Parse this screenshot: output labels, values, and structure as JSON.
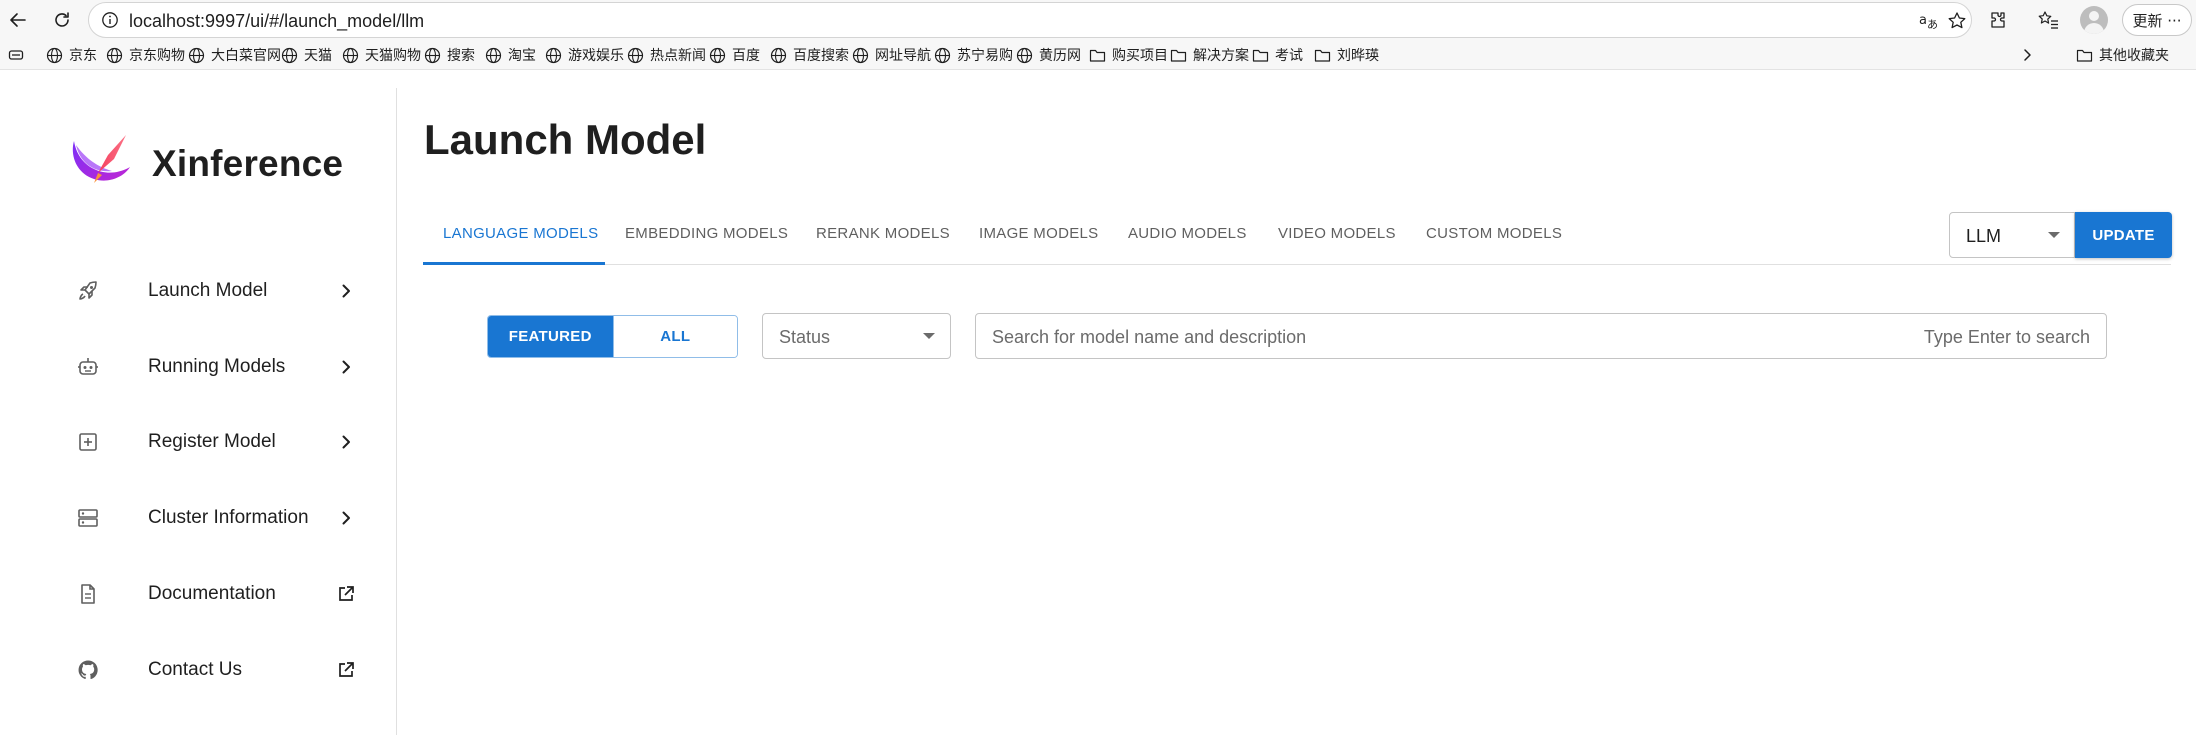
{
  "browser": {
    "url": "localhost:9997/ui/#/launch_model/llm",
    "update_label": "更新 ···"
  },
  "bookmarks": [
    {
      "label": "京东",
      "icon": "globe-icon"
    },
    {
      "label": "京东购物",
      "icon": "globe-icon"
    },
    {
      "label": "大白菜官网",
      "icon": "globe-icon"
    },
    {
      "label": "天猫",
      "icon": "globe-icon"
    },
    {
      "label": "天猫购物",
      "icon": "globe-icon"
    },
    {
      "label": "搜索",
      "icon": "globe-icon"
    },
    {
      "label": "淘宝",
      "icon": "globe-icon"
    },
    {
      "label": "游戏娱乐",
      "icon": "globe-icon"
    },
    {
      "label": "热点新闻",
      "icon": "globe-icon"
    },
    {
      "label": "百度",
      "icon": "globe-icon"
    },
    {
      "label": "百度搜索",
      "icon": "globe-icon"
    },
    {
      "label": "网址导航",
      "icon": "globe-icon"
    },
    {
      "label": "苏宁易购",
      "icon": "globe-icon"
    },
    {
      "label": "黄历网",
      "icon": "globe-icon"
    },
    {
      "label": "购买项目",
      "icon": "folder-icon"
    },
    {
      "label": "解决方案",
      "icon": "folder-icon"
    },
    {
      "label": "考试",
      "icon": "folder-icon"
    },
    {
      "label": "刘晔瑛",
      "icon": "folder-icon"
    }
  ],
  "bookmarks_other": "其他收藏夹",
  "sidebar": {
    "brand": "Xinference",
    "items": [
      {
        "label": "Launch Model",
        "icon": "rocket-icon",
        "trail": "chevron-right-icon"
      },
      {
        "label": "Running Models",
        "icon": "robot-icon",
        "trail": "chevron-right-icon"
      },
      {
        "label": "Register Model",
        "icon": "add-box-icon",
        "trail": "chevron-right-icon"
      },
      {
        "label": "Cluster Information",
        "icon": "server-icon",
        "trail": "chevron-right-icon"
      },
      {
        "label": "Documentation",
        "icon": "document-icon",
        "trail": "open-in-new-icon"
      },
      {
        "label": "Contact Us",
        "icon": "github-icon",
        "trail": "open-in-new-icon"
      }
    ]
  },
  "main": {
    "title": "Launch Model",
    "tabs": [
      {
        "label": "LANGUAGE MODELS",
        "active": true
      },
      {
        "label": "EMBEDDING MODELS",
        "active": false
      },
      {
        "label": "RERANK MODELS",
        "active": false
      },
      {
        "label": "IMAGE MODELS",
        "active": false
      },
      {
        "label": "AUDIO MODELS",
        "active": false
      },
      {
        "label": "VIDEO MODELS",
        "active": false
      },
      {
        "label": "CUSTOM MODELS",
        "active": false
      }
    ],
    "model_type_select": "LLM",
    "update_button": "UPDATE",
    "filter_toggle": {
      "featured": "FEATURED",
      "all": "ALL",
      "selected": "FEATURED"
    },
    "status_select": "Status",
    "search": {
      "placeholder": "Search for model name and description",
      "hint": "Type Enter to search",
      "value": ""
    }
  },
  "colors": {
    "accent": "#1976d2",
    "text": "#1f1f1f",
    "muted": "#6b6b6b"
  }
}
